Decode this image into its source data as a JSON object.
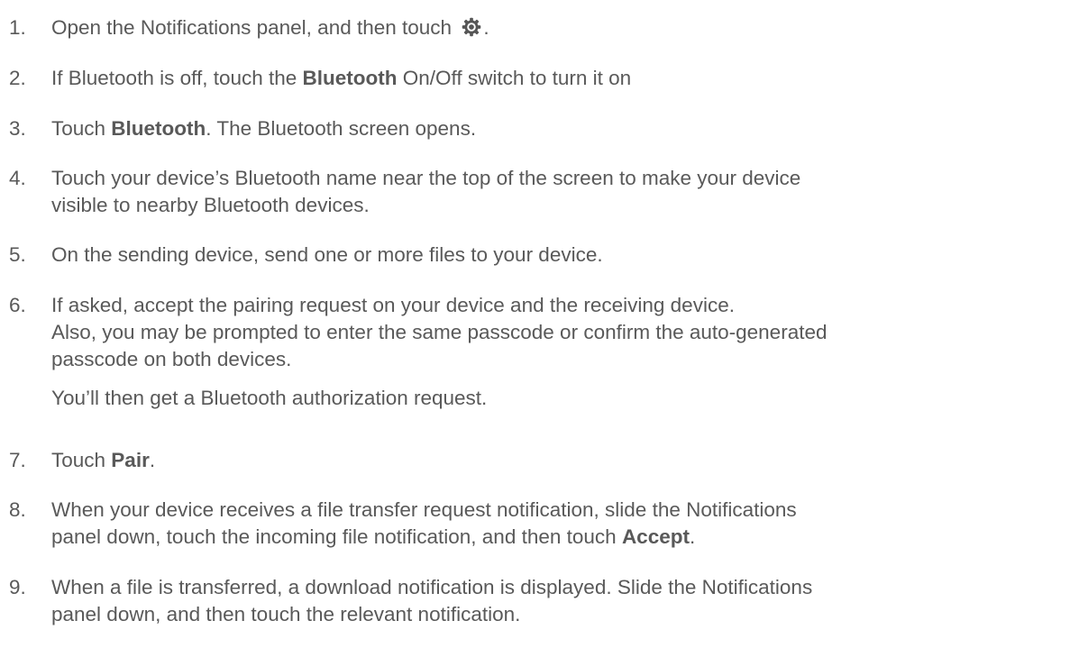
{
  "steps": [
    {
      "num": "1.",
      "lines": [
        {
          "before": "Open the Notifications panel, and then touch ",
          "icon": "settings-gear-icon",
          "after": "."
        }
      ]
    },
    {
      "num": "2.",
      "lines": [
        {
          "before": "If Bluetooth is off, touch the ",
          "bold": "Bluetooth",
          "after": " On/Off switch to turn it on"
        }
      ]
    },
    {
      "num": "3.",
      "lines": [
        {
          "before": "Touch ",
          "bold": "Bluetooth",
          "after": ". The Bluetooth screen opens."
        }
      ]
    },
    {
      "num": "4.",
      "lines": [
        {
          "text": "Touch your device’s Bluetooth name near the top of the screen to make your device"
        },
        {
          "text": "visible to nearby Bluetooth devices."
        }
      ]
    },
    {
      "num": "5.",
      "lines": [
        {
          "text": "On the sending device, send one or more files to your device."
        }
      ]
    },
    {
      "num": "6.",
      "lines": [
        {
          "text": "If asked, accept the pairing request on your device and the receiving device."
        },
        {
          "text": "Also, you may be prompted to enter the same passcode or confirm the auto-generated"
        },
        {
          "text": "passcode on both devices."
        }
      ],
      "extra_paragraph": "You’ll then get a Bluetooth authorization request."
    },
    {
      "num": "7.",
      "lines": [
        {
          "before": "Touch ",
          "bold": "Pair",
          "after": "."
        }
      ]
    },
    {
      "num": "8.",
      "lines": [
        {
          "text": "When your device receives a file transfer request notification, slide the Notifications"
        },
        {
          "before": "panel down, touch the incoming file notification, and then touch ",
          "bold": "Accept",
          "after": "."
        }
      ]
    },
    {
      "num": "9.",
      "lines": [
        {
          "text": "When a file is transferred, a download notification is displayed. Slide the Notifications"
        },
        {
          "text": "panel down, and then touch the relevant notification."
        }
      ]
    }
  ]
}
